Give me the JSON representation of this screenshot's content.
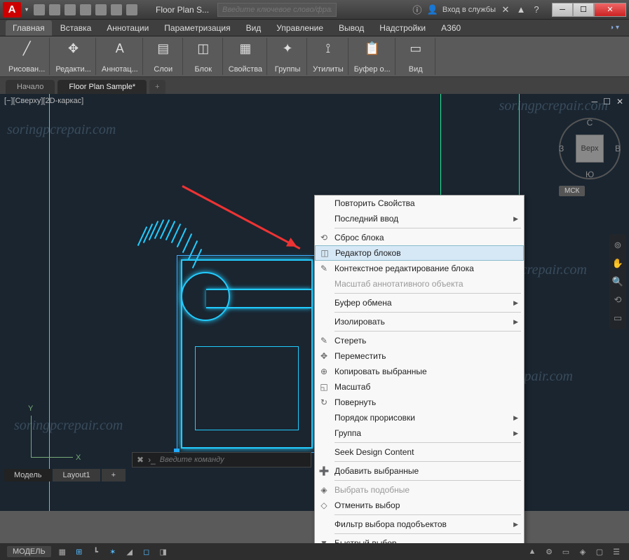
{
  "titlebar": {
    "app_letter": "A",
    "doc_title": "Floor Plan S...",
    "search_placeholder": "Введите ключевое слово/фразу",
    "login": "Вход в службы",
    "win": {
      "min": "─",
      "max": "☐",
      "close": "✕"
    }
  },
  "menubar": {
    "items": [
      "Главная",
      "Вставка",
      "Аннотации",
      "Параметризация",
      "Вид",
      "Управление",
      "Вывод",
      "Надстройки",
      "A360"
    ]
  },
  "ribbon": {
    "groups": [
      {
        "icon": "╱",
        "label": "Рисован..."
      },
      {
        "icon": "✥",
        "label": "Редакти..."
      },
      {
        "icon": "A",
        "label": "Аннотац..."
      },
      {
        "icon": "▤",
        "label": "Слои"
      },
      {
        "icon": "◫",
        "label": "Блок"
      },
      {
        "icon": "▦",
        "label": "Свойства"
      },
      {
        "icon": "✦",
        "label": "Группы"
      },
      {
        "icon": "⟟",
        "label": "Утилиты"
      },
      {
        "icon": "📋",
        "label": "Буфер о..."
      },
      {
        "icon": "▭",
        "label": "Вид"
      }
    ]
  },
  "doc_tabs": {
    "start": "Начало",
    "active": "Floor Plan Sample*",
    "plus": "+"
  },
  "drawing": {
    "view_label": "[−][Сверху][2D-каркас]",
    "axes": {
      "x": "X",
      "y": "Y"
    }
  },
  "viewcube": {
    "top": "Верх",
    "n": "С",
    "s": "Ю",
    "w": "З",
    "e": "В",
    "msk": "МСК"
  },
  "context_menu": {
    "items": [
      {
        "label": "Повторить Свойства",
        "icon": ""
      },
      {
        "label": "Последний ввод",
        "icon": "",
        "sub": true
      },
      {
        "sep": true
      },
      {
        "label": "Сброс блока",
        "icon": "⟲"
      },
      {
        "label": "Редактор блоков",
        "icon": "◫",
        "hover": true
      },
      {
        "label": "Контекстное редактирование блока",
        "icon": "✎"
      },
      {
        "label": "Масштаб аннотативного объекта",
        "icon": "",
        "dis": true
      },
      {
        "sep": true
      },
      {
        "label": "Буфер обмена",
        "icon": "",
        "sub": true
      },
      {
        "sep": true
      },
      {
        "label": "Изолировать",
        "icon": "",
        "sub": true
      },
      {
        "sep": true
      },
      {
        "label": "Стереть",
        "icon": "✎"
      },
      {
        "label": "Переместить",
        "icon": "✥"
      },
      {
        "label": "Копировать выбранные",
        "icon": "⊕"
      },
      {
        "label": "Масштаб",
        "icon": "◱"
      },
      {
        "label": "Повернуть",
        "icon": "↻"
      },
      {
        "label": "Порядок прорисовки",
        "icon": "",
        "sub": true
      },
      {
        "label": "Группа",
        "icon": "",
        "sub": true
      },
      {
        "sep": true
      },
      {
        "label": "Seek Design Content",
        "icon": ""
      },
      {
        "sep": true
      },
      {
        "label": "Добавить выбранные",
        "icon": "➕"
      },
      {
        "sep": true
      },
      {
        "label": "Выбрать подобные",
        "icon": "◈",
        "dis": true
      },
      {
        "label": "Отменить выбор",
        "icon": "◇"
      },
      {
        "sep": true
      },
      {
        "label": "Фильтр выбора подобъектов",
        "icon": "",
        "sub": true
      },
      {
        "sep": true
      },
      {
        "label": "Быстрый выбор...",
        "icon": "▼"
      }
    ]
  },
  "command": {
    "placeholder": "Введите команду"
  },
  "bottom_tabs": {
    "model": "Модель",
    "layout": "Layout1",
    "plus": "+"
  },
  "status": {
    "model": "МОДЕЛЬ"
  },
  "watermark": "soringpcrepair.com"
}
